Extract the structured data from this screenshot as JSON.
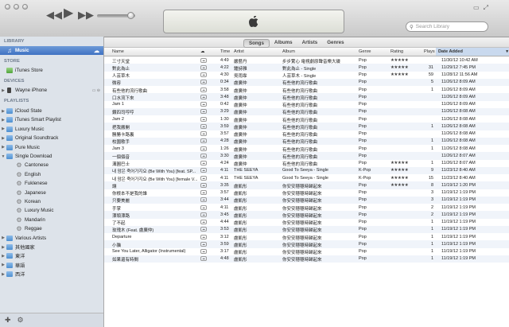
{
  "window": {
    "prev_icon": "rewind-icon",
    "play_icon": "play-icon",
    "next_icon": "fast-forward-icon",
    "search_placeholder": "Search Library"
  },
  "sidebar": {
    "library_header": "LIBRARY",
    "music_label": "Music",
    "store_header": "STORE",
    "itunes_store_label": "iTunes Store",
    "devices_header": "DEVICES",
    "device_label": "Wayne iPhone",
    "playlists_header": "PLAYLISTS",
    "playlists": [
      {
        "label": "iCloud State",
        "type": "folder",
        "arrow": "▶"
      },
      {
        "label": "iTunes Smart Playlist",
        "type": "folder",
        "arrow": "▶"
      },
      {
        "label": "Luxury Music",
        "type": "folder",
        "arrow": "▶"
      },
      {
        "label": "Original Soundtrack",
        "type": "folder",
        "arrow": "▶"
      },
      {
        "label": "Pure Music",
        "type": "folder",
        "arrow": "▶"
      },
      {
        "label": "Single Download",
        "type": "folder",
        "arrow": "▼"
      },
      {
        "label": "Cantonese",
        "type": "smart",
        "arrow": ""
      },
      {
        "label": "English",
        "type": "smart",
        "arrow": ""
      },
      {
        "label": "Fuklenese",
        "type": "smart",
        "arrow": ""
      },
      {
        "label": "Japanese",
        "type": "smart",
        "arrow": ""
      },
      {
        "label": "Korean",
        "type": "smart",
        "arrow": ""
      },
      {
        "label": "Luxury Music",
        "type": "smart",
        "arrow": ""
      },
      {
        "label": "Mandarin",
        "type": "smart",
        "arrow": ""
      },
      {
        "label": "Reggae",
        "type": "smart",
        "arrow": ""
      },
      {
        "label": "Various Artists",
        "type": "folder",
        "arrow": "▶"
      },
      {
        "label": "其他國家",
        "type": "folder",
        "arrow": "▶"
      },
      {
        "label": "東洋",
        "type": "folder",
        "arrow": "▶"
      },
      {
        "label": "華語",
        "type": "folder",
        "arrow": "▶"
      },
      {
        "label": "西洋",
        "type": "folder",
        "arrow": "▶"
      }
    ]
  },
  "view_tabs": [
    "Songs",
    "Albums",
    "Artists",
    "Genres"
  ],
  "columns": {
    "name": "Name",
    "time": "Time",
    "artist": "Artist",
    "album": "Album",
    "genre": "Genre",
    "rating": "Rating",
    "plays": "Plays",
    "date_added": "Date Added"
  },
  "songs": [
    {
      "name": "三寸天堂",
      "time": "4:49",
      "artist": "嚴藝丹",
      "album": "步步驚心 電視劇原聲音樂大碟",
      "genre": "Pop",
      "rating": "★★★★★",
      "plays": "",
      "date": "11/30/12 10:42 AM"
    },
    {
      "name": "對此為止",
      "time": "4:22",
      "artist": "鍾詩雅",
      "album": "對此為止 - Single",
      "genre": "Pop",
      "rating": "★★★★★",
      "plays": "31",
      "date": "11/29/12 7:45 PM"
    },
    {
      "name": "人芸草木",
      "time": "4:30",
      "artist": "吳雨霏",
      "album": "人芸草木 - Single",
      "genre": "Pop",
      "rating": "★★★★★",
      "plays": "59",
      "date": "11/28/12 11:56 AM"
    },
    {
      "name": "微容",
      "time": "0:34",
      "artist": "盧廣仲",
      "album": "有些他的流行歌曲",
      "genre": "Pop",
      "rating": "",
      "plays": "5",
      "date": "11/26/12 8:09 AM"
    },
    {
      "name": "有些他的流行歌曲",
      "time": "3:58",
      "artist": "盧廣仲",
      "album": "有些他的流行歌曲",
      "genre": "Pop",
      "rating": "",
      "plays": "1",
      "date": "11/26/12 8:09 AM"
    },
    {
      "name": "口水流下來",
      "time": "3:48",
      "artist": "盧廣仲",
      "album": "有些他的流行歌曲",
      "genre": "Pop",
      "rating": "",
      "plays": "",
      "date": "11/26/12 8:09 AM"
    },
    {
      "name": "Jam 1",
      "time": "0:42",
      "artist": "盧廣仲",
      "album": "有些他的流行歌曲",
      "genre": "Pop",
      "rating": "",
      "plays": "",
      "date": "11/26/12 8:09 AM"
    },
    {
      "name": "鑽四司哼哼",
      "time": "3:29",
      "artist": "盧廣仲",
      "album": "有些他的流行歌曲",
      "genre": "Pop",
      "rating": "",
      "plays": "",
      "date": "11/26/12 8:08 AM"
    },
    {
      "name": "Jam 2",
      "time": "1:30",
      "artist": "盧廣仲",
      "album": "有些他的流行歌曲",
      "genre": "Pop",
      "rating": "",
      "plays": "",
      "date": "11/26/12 8:08 AM"
    },
    {
      "name": "把我搬開",
      "time": "3:59",
      "artist": "盧廣仲",
      "album": "有些他的流行歌曲",
      "genre": "Pop",
      "rating": "",
      "plays": "1",
      "date": "11/26/12 8:08 AM"
    },
    {
      "name": "勝勝卡路裏",
      "time": "3:57",
      "artist": "盧廣仲",
      "album": "有些他的流行歌曲",
      "genre": "Pop",
      "rating": "",
      "plays": "",
      "date": "11/26/12 8:08 AM"
    },
    {
      "name": "校園歌手",
      "time": "4:28",
      "artist": "盧廣仲",
      "album": "有些他的流行歌曲",
      "genre": "Pop",
      "rating": "",
      "plays": "1",
      "date": "11/26/12 8:08 AM"
    },
    {
      "name": "Jam 3",
      "time": "1:26",
      "artist": "盧廣仲",
      "album": "有些他的流行歌曲",
      "genre": "Pop",
      "rating": "",
      "plays": "1",
      "date": "11/26/12 8:08 AM"
    },
    {
      "name": "一個個音",
      "time": "3:30",
      "artist": "盧廣仲",
      "album": "有些他的流行歌曲",
      "genre": "Pop",
      "rating": "",
      "plays": "",
      "date": "11/26/12 8:07 AM"
    },
    {
      "name": "溝圓巴士",
      "time": "4:24",
      "artist": "盧廣仲",
      "album": "有些他的流行歌曲",
      "genre": "Pop",
      "rating": "★★★★★",
      "plays": "1",
      "date": "11/26/12 8:07 AM"
    },
    {
      "name": "내 맘은 죽어가지요 (Be With You) [feat. SP...",
      "time": "4:11",
      "artist": "THE SEEYA",
      "album": "Good To Seeya - Single",
      "genre": "K-Pop",
      "rating": "★★★★★",
      "plays": "9",
      "date": "11/23/12 8:40 AM"
    },
    {
      "name": "내 맘은 죽어가지요 (Be With You) [female V...",
      "time": "4:11",
      "artist": "THE SEEYA",
      "album": "Good To Seeya - Single",
      "genre": "K-Pop",
      "rating": "★★★★★",
      "plays": "15",
      "date": "11/23/12 8:40 AM"
    },
    {
      "name": "讓",
      "time": "3:35",
      "artist": "盧凱彤",
      "album": "你安安穩穩時歸起來",
      "genre": "Pop",
      "rating": "★★★★★",
      "plays": "8",
      "date": "11/19/12 1:20 PM"
    },
    {
      "name": "你根本不是我的誰",
      "time": "3:57",
      "artist": "盧凱彤",
      "album": "你安安穩穩時歸起來",
      "genre": "Pop",
      "rating": "",
      "plays": "3",
      "date": "11/19/12 1:19 PM"
    },
    {
      "name": "只要美麗",
      "time": "3:44",
      "artist": "盧凱彤",
      "album": "你安安穩穩時歸起來",
      "genre": "Pop",
      "rating": "",
      "plays": "3",
      "date": "11/19/12 1:19 PM"
    },
    {
      "name": "手掌",
      "time": "4:11",
      "artist": "盧凱彤",
      "album": "你安安穩穩時歸起來",
      "genre": "Pop",
      "rating": "",
      "plays": "2",
      "date": "11/19/12 1:19 PM"
    },
    {
      "name": "漂頭漂路",
      "time": "3:45",
      "artist": "盧凱彤",
      "album": "你安安穩穩時歸起來",
      "genre": "Pop",
      "rating": "",
      "plays": "2",
      "date": "11/19/12 1:19 PM"
    },
    {
      "name": "了不起",
      "time": "4:44",
      "artist": "盧凱彤",
      "album": "你安安穩穩時歸起來",
      "genre": "Pop",
      "rating": "",
      "plays": "1",
      "date": "11/19/12 1:19 PM"
    },
    {
      "name": "玫瑰木 (Feat. 盧廣仲)",
      "time": "3:53",
      "artist": "盧凱彤",
      "album": "你安安穩穩時歸起來",
      "genre": "Pop",
      "rating": "",
      "plays": "1",
      "date": "11/19/12 1:19 PM"
    },
    {
      "name": "Departure",
      "time": "3:12",
      "artist": "盧凱彤",
      "album": "你安安穩穩時歸起來",
      "genre": "Pop",
      "rating": "",
      "plays": "1",
      "date": "11/19/12 1:19 PM"
    },
    {
      "name": "小貓",
      "time": "3:59",
      "artist": "盧凱彤",
      "album": "你安安穩穩時歸起來",
      "genre": "Pop",
      "rating": "",
      "plays": "1",
      "date": "11/19/12 1:19 PM"
    },
    {
      "name": "See You Later, Alligator (Instrumental)",
      "time": "3:17",
      "artist": "盧凱彤",
      "album": "你安安穩穩時歸起來",
      "genre": "Pop",
      "rating": "",
      "plays": "1",
      "date": "11/19/12 1:19 PM"
    },
    {
      "name": "如果還有時間",
      "time": "4:48",
      "artist": "盧凱彤",
      "album": "你安安穩穩時歸起來",
      "genre": "Pop",
      "rating": "",
      "plays": "1",
      "date": "11/19/12 1:19 PM"
    }
  ]
}
